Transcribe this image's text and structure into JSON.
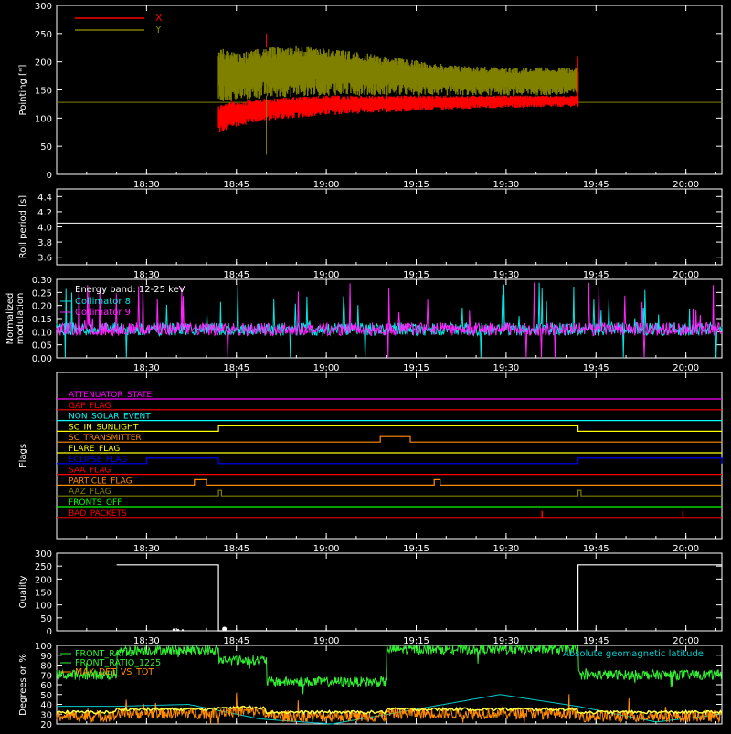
{
  "colors": {
    "background": "#000000",
    "axis": "#ffffff",
    "x_pointing": "#ff0000",
    "y_pointing": "#808000",
    "collimator8": "#00e5e5",
    "collimator9": "#ff22ff",
    "front_ratio": "#33ee33",
    "max_det": "#ff8c00",
    "yellow_series": "#ffff44",
    "latitude": "#00cccc"
  },
  "time_axis": {
    "start_minutes": 1095,
    "end_minutes": 1206,
    "tick_minutes": [
      1110,
      1125,
      1140,
      1155,
      1170,
      1185,
      1200
    ],
    "tick_labels": [
      "18:30",
      "18:45",
      "19:00",
      "19:15",
      "19:30",
      "19:45",
      "20:00"
    ]
  },
  "chart_data": [
    {
      "type": "line",
      "ylabel": "Pointing [\"]",
      "ylim": [
        0,
        300
      ],
      "yticks": [
        0,
        50,
        100,
        150,
        200,
        250,
        300
      ],
      "legend": [
        "X",
        "Y"
      ],
      "data_start": "18:42",
      "data_end": "19:42",
      "baseline": 128,
      "series": [
        {
          "name": "X",
          "color": "#ff0000",
          "time": [
            "18:42",
            "18:45",
            "18:50",
            "18:55",
            "19:00",
            "19:10",
            "19:20",
            "19:30",
            "19:42"
          ],
          "min": [
            70,
            85,
            95,
            100,
            105,
            110,
            115,
            118,
            120
          ],
          "max": [
            125,
            130,
            135,
            138,
            140,
            140,
            140,
            140,
            140
          ]
        },
        {
          "name": "Y",
          "color": "#808000",
          "time": [
            "18:42",
            "18:45",
            "18:50",
            "18:55",
            "19:00",
            "19:10",
            "19:20",
            "19:30",
            "19:42"
          ],
          "min": [
            125,
            130,
            135,
            138,
            140,
            140,
            140,
            140,
            140
          ],
          "max": [
            225,
            215,
            225,
            230,
            225,
            210,
            195,
            190,
            190
          ]
        }
      ]
    },
    {
      "type": "line",
      "ylabel": "Roll period [s]",
      "ylim": [
        3.5,
        4.5
      ],
      "yticks": [
        3.6,
        3.8,
        4.0,
        4.2,
        4.4
      ],
      "ytick_labels": [
        "3.6",
        "3.8",
        "4.0",
        "4.2",
        "4.4"
      ],
      "series": [
        {
          "values_constant": 4.05
        }
      ]
    },
    {
      "type": "line",
      "ylabel": "Normalized modulation",
      "ylabel_lines": [
        "Normalized",
        "modulation"
      ],
      "ylim": [
        0,
        0.3
      ],
      "yticks": [
        0.0,
        0.05,
        0.1,
        0.15,
        0.2,
        0.25,
        0.3
      ],
      "ytick_labels": [
        "0.00",
        "0.05",
        "0.10",
        "0.15",
        "0.20",
        "0.25",
        "0.30"
      ],
      "annotation": "Energy band: 12-25 keV",
      "legend": [
        "Collimator 8",
        "Collimator 9"
      ],
      "series": [
        {
          "name": "Collimator 8",
          "color": "#00e5e5",
          "mean": 0.11
        },
        {
          "name": "Collimator 9",
          "color": "#ff22ff",
          "mean": 0.11
        }
      ]
    },
    {
      "type": "line",
      "ylabel": "Flags",
      "flags": [
        {
          "name": "ATTENUATOR_STATE",
          "color": "#ff00ff",
          "high": []
        },
        {
          "name": "GAP_FLAG",
          "color": "#ff0000",
          "high": []
        },
        {
          "name": "NON_SOLAR_EVENT",
          "color": "#00ffff",
          "high": []
        },
        {
          "name": "SC_IN_SUNLIGHT",
          "color": "#ffff00",
          "high": [
            [
              "18:42",
              "19:42"
            ]
          ]
        },
        {
          "name": "SC_TRANSMITTER",
          "color": "#ff8c00",
          "high": [
            [
              "19:09",
              "19:14"
            ]
          ]
        },
        {
          "name": "FLARE_FLAG",
          "color": "#ffff00",
          "high": []
        },
        {
          "name": "ECLIPSE_FLAG",
          "color": "#0000ff",
          "high": [
            [
              "18:30",
              "18:42"
            ],
            [
              "19:42",
              "20:06"
            ]
          ]
        },
        {
          "name": "SAA_FLAG",
          "color": "#ff0000",
          "high": []
        },
        {
          "name": "PARTICLE_FLAG",
          "color": "#ff8c00",
          "high": [
            [
              "18:38",
              "18:40"
            ],
            [
              "19:18",
              "19:19"
            ]
          ]
        },
        {
          "name": "AAZ_FLAG",
          "color": "#808000",
          "high": [
            [
              "18:42",
              "18:42.5"
            ],
            [
              "19:42",
              "19:42.5"
            ]
          ]
        },
        {
          "name": "FRONTS_OFF",
          "color": "#00ff00",
          "high": []
        },
        {
          "name": "BAD_PACKETS",
          "color": "#ff0000",
          "spikes": [
            "19:36",
            "19:59.5"
          ]
        }
      ]
    },
    {
      "type": "line",
      "ylabel": "Quality",
      "ylim": [
        0,
        300
      ],
      "yticks": [
        0,
        50,
        100,
        150,
        200,
        250,
        300
      ],
      "series": [
        {
          "name": "Quality",
          "time": [
            "18:25",
            "18:42",
            "18:42",
            "19:42",
            "19:42",
            "20:06"
          ],
          "values": [
            255,
            255,
            0,
            0,
            255,
            255
          ]
        }
      ]
    },
    {
      "type": "line",
      "ylabel": "Degrees or %",
      "ylim": [
        20,
        100
      ],
      "yticks": [
        20,
        30,
        40,
        50,
        60,
        70,
        80,
        90,
        100
      ],
      "legend": [
        "FRONT_RATIO",
        "FRONT_RATIO_1225",
        "MAX_DET_VS_TOT"
      ],
      "annotation": "Absolute geomagnetic latitude",
      "series": [
        {
          "name": "FRONT_RATIO",
          "color": "#33ee33",
          "segments": [
            [
              "18:25",
              "18:42",
              95
            ],
            [
              "18:42",
              "18:50",
              85
            ],
            [
              "18:50",
              "19:10",
              63
            ],
            [
              "19:10",
              "19:42",
              96
            ],
            [
              "19:42",
              "20:06",
              70
            ]
          ]
        },
        {
          "name": "MAX_DET_VS_TOT",
          "color": "#ff8c00",
          "segments": [
            [
              "18:25",
              "18:42",
              31
            ],
            [
              "18:42",
              "18:50",
              33
            ],
            [
              "18:50",
              "19:10",
              28
            ],
            [
              "19:10",
              "19:42",
              31
            ],
            [
              "19:42",
              "20:06",
              28
            ]
          ]
        },
        {
          "name": "Absolute geomagnetic latitude",
          "color": "#00cccc",
          "time": [
            "18:25",
            "18:37",
            "18:49",
            "19:01",
            "19:15",
            "19:29",
            "19:42",
            "19:55",
            "20:06"
          ],
          "values": [
            38,
            40,
            25,
            20,
            35,
            50,
            38,
            22,
            30
          ]
        }
      ]
    }
  ]
}
